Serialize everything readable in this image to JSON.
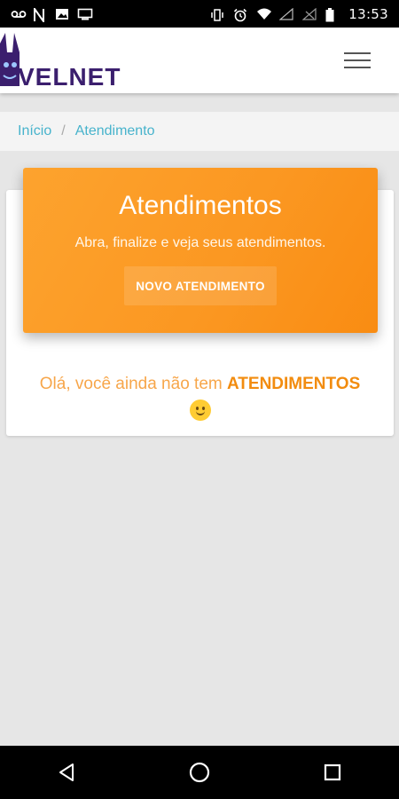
{
  "status_bar": {
    "time": "13:53",
    "icons": [
      "voicemail-icon",
      "n-notification-icon",
      "image-icon",
      "cast-icon",
      "vibrate-icon",
      "alarm-icon",
      "wifi-icon",
      "signal-icon",
      "no-signal-icon",
      "battery-icon"
    ]
  },
  "header": {
    "logo_text": "VELNET",
    "menu_icon": "hamburger-menu-icon"
  },
  "breadcrumb": {
    "items": [
      "Início",
      "Atendimento"
    ],
    "separator": "/"
  },
  "hero": {
    "title": "Atendimentos",
    "subtitle": "Abra, finalize e veja seus atendimentos.",
    "button_label": "NOVO ATENDIMENTO"
  },
  "empty_state": {
    "message_prefix": "Olá, você ainda não tem ",
    "message_highlight": "ATENDIMENTOS",
    "emoji": "🙂"
  },
  "nav_bar": {
    "buttons": [
      "back-icon",
      "home-icon",
      "recents-icon"
    ]
  },
  "colors": {
    "accent_orange": "#fb9721",
    "breadcrumb_link": "#47b3cc",
    "brand_purple": "#3b1f6e"
  }
}
